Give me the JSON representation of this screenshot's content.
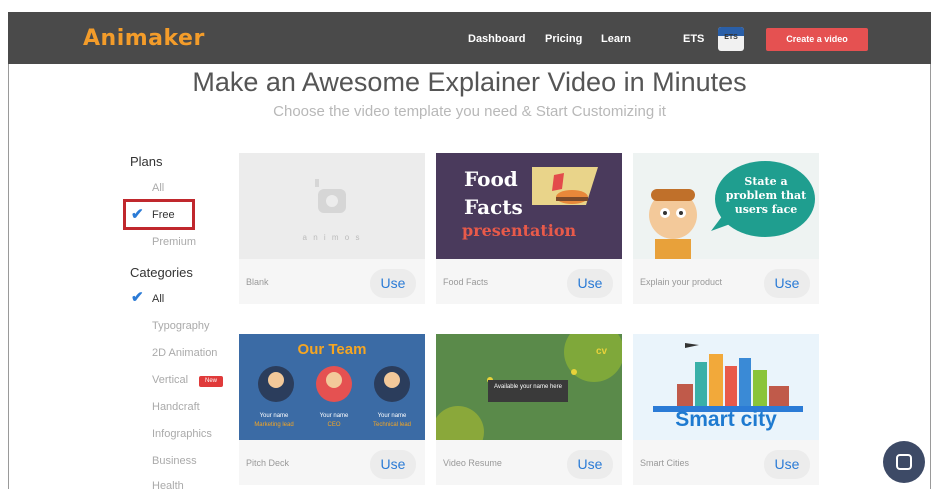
{
  "navbar": {
    "logo": "Animaker",
    "links": [
      "Dashboard",
      "Pricing",
      "Learn",
      "ETS"
    ],
    "ets_badge": "ETS",
    "create_button": "Create a video"
  },
  "hero": {
    "title": "Make an Awesome Explainer Video in Minutes",
    "subtitle": "Choose the video template you need & Start Customizing it"
  },
  "sidebar": {
    "plans_heading": "Plans",
    "plans": [
      {
        "label": "All",
        "selected": false
      },
      {
        "label": "Free",
        "selected": true
      },
      {
        "label": "Premium",
        "selected": false
      }
    ],
    "categories_heading": "Categories",
    "categories": [
      {
        "label": "All",
        "selected": true
      },
      {
        "label": "Typography",
        "selected": false
      },
      {
        "label": "2D Animation",
        "selected": false
      },
      {
        "label": "Vertical",
        "selected": false,
        "badge": "New"
      },
      {
        "label": "Handcraft",
        "selected": false
      },
      {
        "label": "Infographics",
        "selected": false
      },
      {
        "label": "Business",
        "selected": false
      },
      {
        "label": "Health",
        "selected": false
      }
    ]
  },
  "templates": [
    {
      "name": "Blank",
      "use_label": "Use",
      "thumb_text": "a n i m o s"
    },
    {
      "name": "Food Facts",
      "use_label": "Use",
      "thumb_line1": "Food",
      "thumb_line2": "Facts",
      "thumb_line3": "presentation"
    },
    {
      "name": "Explain your product",
      "use_label": "Use",
      "thumb_text": "State a problem that users face"
    },
    {
      "name": "Pitch Deck",
      "use_label": "Use",
      "thumb_title": "Our Team",
      "people": [
        {
          "name": "Your name",
          "role": "Marketing lead"
        },
        {
          "name": "Your name",
          "role": "CEO"
        },
        {
          "name": "Your name",
          "role": "Technical lead"
        }
      ]
    },
    {
      "name": "Video Resume",
      "use_label": "Use",
      "thumb_label": "Available your name here",
      "thumb_corner": "cv"
    },
    {
      "name": "Smart Cities",
      "use_label": "Use",
      "thumb_text": "Smart city"
    }
  ],
  "colors": {
    "navbar_bg": "#4a4a4a",
    "logo": "#f39c2a",
    "create_button": "#e55151",
    "accent_blue": "#2b7bd6",
    "highlight_box": "#c0282d",
    "chat_bubble": "#3d4a66"
  }
}
